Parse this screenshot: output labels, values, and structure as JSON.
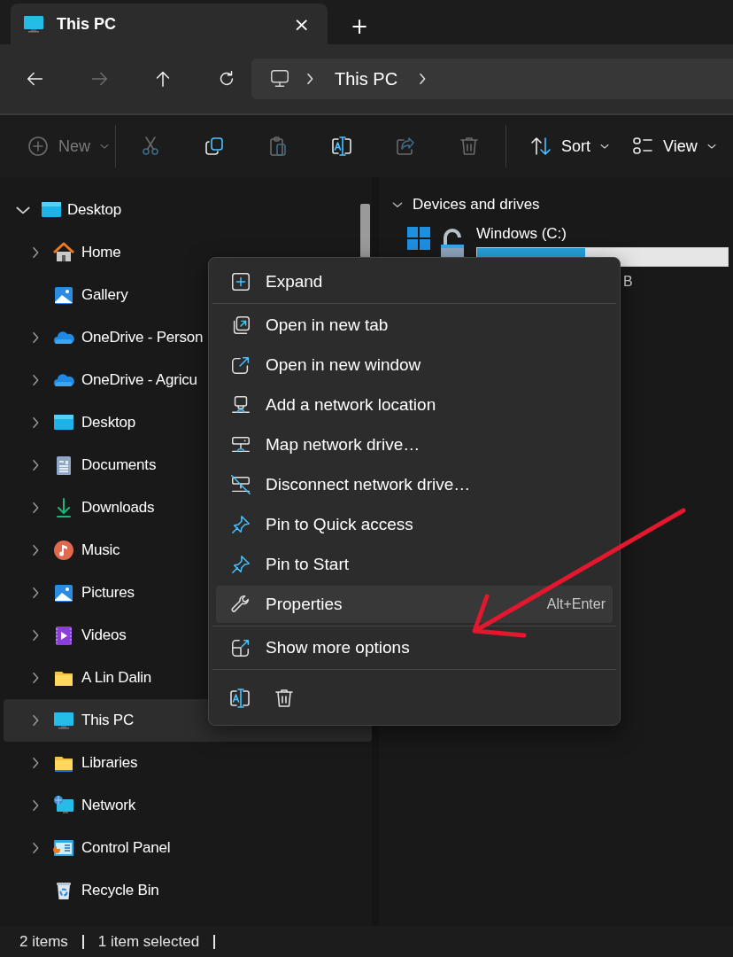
{
  "tab": {
    "title": "This PC",
    "close": "×",
    "new_tab": "+"
  },
  "navigation": {
    "buttons": [
      {
        "kind": "back",
        "disabled": false
      },
      {
        "kind": "forward",
        "disabled": true
      },
      {
        "kind": "up",
        "disabled": false
      },
      {
        "kind": "refresh",
        "disabled": false
      }
    ],
    "address": {
      "segments": [
        "This PC"
      ]
    }
  },
  "command_bar": {
    "items": [
      {
        "kind": "new",
        "label": "New",
        "disabled": true
      },
      {
        "kind": "separator"
      },
      {
        "kind": "cut",
        "disabled": true
      },
      {
        "kind": "copy",
        "disabled": false
      },
      {
        "kind": "paste",
        "disabled": true
      },
      {
        "kind": "rename",
        "disabled": false
      },
      {
        "kind": "share",
        "disabled": true
      },
      {
        "kind": "delete",
        "disabled": true
      },
      {
        "kind": "separator"
      },
      {
        "kind": "sort",
        "label": "Sort",
        "disabled": false
      },
      {
        "kind": "view",
        "label": "View",
        "disabled": false
      }
    ]
  },
  "sidebar": {
    "items": [
      {
        "label": "Desktop",
        "kind": "desktop",
        "expandable": true,
        "expanded": true,
        "selected": false,
        "children": [
          {
            "label": "Home",
            "kind": "home",
            "expandable": true,
            "expanded": false,
            "selected": false
          },
          {
            "label": "Gallery",
            "kind": "gallery",
            "expandable": false,
            "selected": false
          },
          {
            "label": "OneDrive - Person",
            "kind": "cloud",
            "expandable": true,
            "expanded": false,
            "selected": false
          },
          {
            "label": "OneDrive - Agricu",
            "kind": "cloud",
            "expandable": true,
            "expanded": false,
            "selected": false
          },
          {
            "label": "Desktop",
            "kind": "desktop",
            "expandable": true,
            "expanded": false,
            "selected": false
          },
          {
            "label": "Documents",
            "kind": "documents",
            "expandable": true,
            "expanded": false,
            "selected": false
          },
          {
            "label": "Downloads",
            "kind": "downloads",
            "expandable": true,
            "expanded": false,
            "selected": false
          },
          {
            "label": "Music",
            "kind": "music",
            "expandable": true,
            "expanded": false,
            "selected": false
          },
          {
            "label": "Pictures",
            "kind": "pictures",
            "expandable": true,
            "expanded": false,
            "selected": false
          },
          {
            "label": "Videos",
            "kind": "videos",
            "expandable": true,
            "expanded": false,
            "selected": false
          },
          {
            "label": "A Lin Dalin",
            "kind": "folder",
            "expandable": true,
            "expanded": false,
            "selected": false
          },
          {
            "label": "This PC",
            "kind": "pc",
            "expandable": true,
            "expanded": false,
            "selected": true
          },
          {
            "label": "Libraries",
            "kind": "libraries",
            "expandable": true,
            "expanded": false,
            "selected": false
          },
          {
            "label": "Network",
            "kind": "network",
            "expandable": true,
            "expanded": false,
            "selected": false
          },
          {
            "label": "Control Panel",
            "kind": "control",
            "expandable": true,
            "expanded": false,
            "selected": false
          },
          {
            "label": "Recycle Bin",
            "kind": "recycle",
            "expandable": false,
            "selected": false
          }
        ]
      }
    ]
  },
  "content": {
    "groups": [
      {
        "title": "Devices and drives",
        "expanded": true,
        "drives": [
          {
            "name": "Windows (C:)",
            "level": 0.43,
            "detail": "B"
          }
        ]
      }
    ]
  },
  "context_menu": {
    "groups": [
      {
        "items": [
          {
            "kind": "expand",
            "label": "Expand",
            "selected": false
          }
        ]
      },
      {
        "items": [
          {
            "kind": "newtab",
            "label": "Open in new tab",
            "selected": false
          },
          {
            "kind": "newwindow",
            "label": "Open in new window",
            "selected": false
          },
          {
            "kind": "addnet",
            "label": "Add a network location",
            "selected": false
          },
          {
            "kind": "mapdrive",
            "label": "Map network drive…",
            "selected": false
          },
          {
            "kind": "disconnect",
            "label": "Disconnect network drive…",
            "selected": false
          },
          {
            "kind": "pin",
            "label": "Pin to Quick access",
            "selected": false
          },
          {
            "kind": "pin",
            "label": "Pin to Start",
            "selected": false
          },
          {
            "kind": "properties",
            "label": "Properties",
            "shortcut": "Alt+Enter",
            "selected": true
          }
        ]
      },
      {
        "items": [
          {
            "kind": "more",
            "label": "Show more options",
            "selected": false
          }
        ]
      }
    ],
    "actions": [
      {
        "kind": "rename"
      },
      {
        "kind": "delete"
      }
    ]
  },
  "status_bar": {
    "items": [
      "2 items",
      "1 item selected"
    ]
  }
}
